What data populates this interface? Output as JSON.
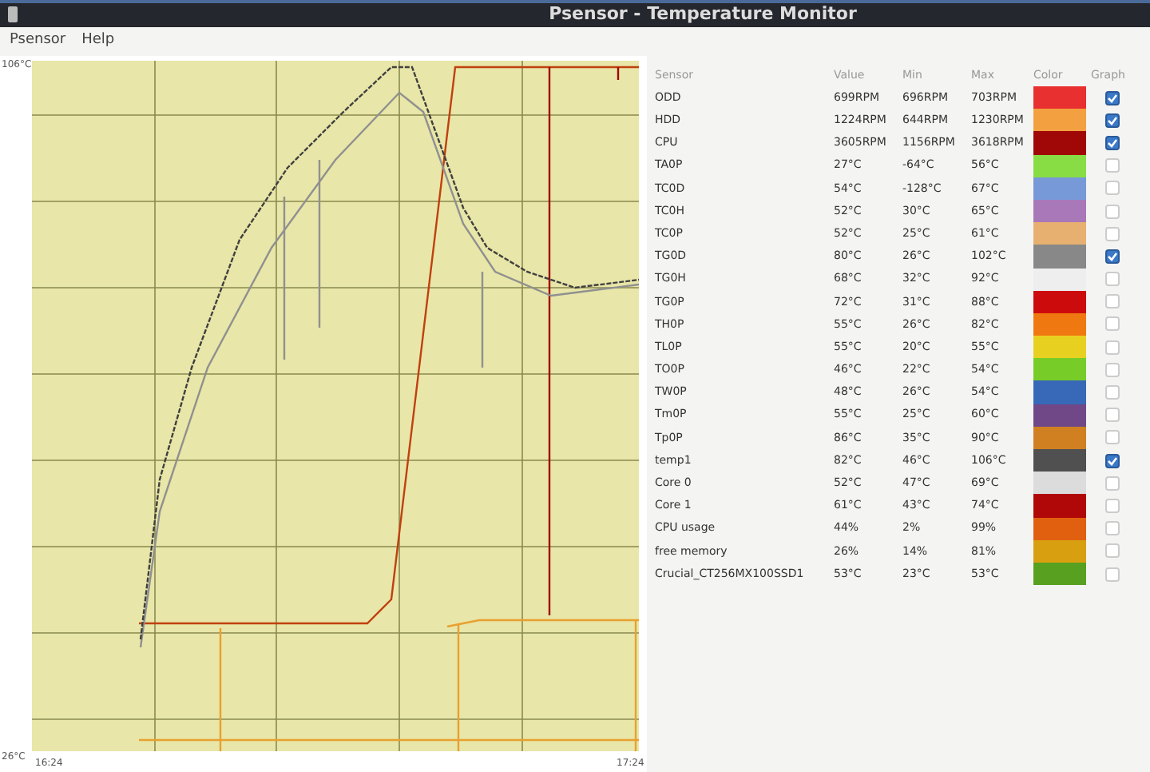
{
  "window": {
    "title": "Psensor - Temperature Monitor"
  },
  "menu": [
    "Psensor",
    "Help"
  ],
  "graph": {
    "y_max_label": "106°C",
    "y_min_label": "26°C",
    "x_start_label": "16:24",
    "x_end_label": "17:24"
  },
  "columns": [
    "Sensor",
    "Value",
    "Min",
    "Max",
    "Color",
    "Graph"
  ],
  "sensors": [
    {
      "name": "ODD",
      "value": "699RPM",
      "min": "696RPM",
      "max": "703RPM",
      "color": "#e83030",
      "graph": true
    },
    {
      "name": "HDD",
      "value": "1224RPM",
      "min": "644RPM",
      "max": "1230RPM",
      "color": "#f2a040",
      "graph": true
    },
    {
      "name": "CPU",
      "value": "3605RPM",
      "min": "1156RPM",
      "max": "3618RPM",
      "color": "#a00808",
      "graph": true
    },
    {
      "name": "TA0P",
      "value": "27°C",
      "min": "-64°C",
      "max": "56°C",
      "color": "#88dd44",
      "graph": false
    },
    {
      "name": "TC0D",
      "value": "54°C",
      "min": "-128°C",
      "max": "67°C",
      "color": "#7799d8",
      "graph": false
    },
    {
      "name": "TC0H",
      "value": "52°C",
      "min": "30°C",
      "max": "65°C",
      "color": "#a878b8",
      "graph": false
    },
    {
      "name": "TC0P",
      "value": "52°C",
      "min": "25°C",
      "max": "61°C",
      "color": "#e8b070",
      "graph": false
    },
    {
      "name": "TG0D",
      "value": "80°C",
      "min": "26°C",
      "max": "102°C",
      "color": "#888888",
      "graph": true
    },
    {
      "name": "TG0H",
      "value": "68°C",
      "min": "32°C",
      "max": "92°C",
      "color": "#eeeeee",
      "graph": false
    },
    {
      "name": "TG0P",
      "value": "72°C",
      "min": "31°C",
      "max": "88°C",
      "color": "#cc0c0c",
      "graph": false
    },
    {
      "name": "TH0P",
      "value": "55°C",
      "min": "26°C",
      "max": "82°C",
      "color": "#f07810",
      "graph": false
    },
    {
      "name": "TL0P",
      "value": "55°C",
      "min": "20°C",
      "max": "55°C",
      "color": "#e8d020",
      "graph": false
    },
    {
      "name": "TO0P",
      "value": "46°C",
      "min": "22°C",
      "max": "54°C",
      "color": "#78cc28",
      "graph": false
    },
    {
      "name": "TW0P",
      "value": "48°C",
      "min": "26°C",
      "max": "54°C",
      "color": "#3868b8",
      "graph": false
    },
    {
      "name": "Tm0P",
      "value": "55°C",
      "min": "25°C",
      "max": "60°C",
      "color": "#704888",
      "graph": false
    },
    {
      "name": "Tp0P",
      "value": "86°C",
      "min": "35°C",
      "max": "90°C",
      "color": "#d08020",
      "graph": false
    },
    {
      "name": "temp1",
      "value": "82°C",
      "min": "46°C",
      "max": "106°C",
      "color": "#505050",
      "graph": true
    },
    {
      "name": "Core 0",
      "value": "52°C",
      "min": "47°C",
      "max": "69°C",
      "color": "#dcdcdc",
      "graph": false
    },
    {
      "name": "Core 1",
      "value": "61°C",
      "min": "43°C",
      "max": "74°C",
      "color": "#b00808",
      "graph": false
    },
    {
      "name": "CPU usage",
      "value": "44%",
      "min": "2%",
      "max": "99%",
      "color": "#e06010",
      "graph": false
    },
    {
      "name": "free memory",
      "value": "26%",
      "min": "14%",
      "max": "81%",
      "color": "#d8a010",
      "graph": false
    },
    {
      "name": "Crucial_CT256MX100SSD1",
      "value": "53°C",
      "min": "23°C",
      "max": "53°C",
      "color": "#58a020",
      "graph": false
    }
  ]
}
